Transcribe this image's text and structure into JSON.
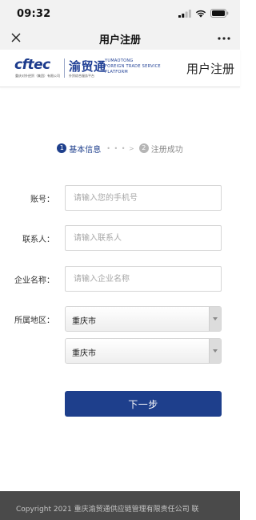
{
  "status_bar": {
    "time": "09:32"
  },
  "nav_bar": {
    "title": "用户注册"
  },
  "header": {
    "logo": {
      "cftec": "cftec",
      "cftec_sub": "重庆对外经贸（集团）有限公司",
      "yumaotong": "渝贸通",
      "yumaotong_sub": "外贸综合服务平台",
      "en_line1": "YUMAOTONG",
      "en_line2": "FOREIGN TRADE SERVICE",
      "en_line3": "PLATFORM"
    },
    "title": "用户注册"
  },
  "steps": [
    {
      "number": "1",
      "label": "基本信息"
    },
    {
      "arrow": "• • • >"
    },
    {
      "number": "2",
      "label": "注册成功"
    }
  ],
  "form": {
    "account": {
      "label": "账号：",
      "placeholder": "请输入您的手机号",
      "value": ""
    },
    "contact": {
      "label": "联系人：",
      "placeholder": "请输入联系人",
      "value": ""
    },
    "company": {
      "label": "企业名称：",
      "placeholder": "请输入企业名称",
      "value": ""
    },
    "region": {
      "label": "所属地区：",
      "province": "重庆市",
      "city": "重庆市"
    },
    "next_button": "下一步"
  },
  "footer": {
    "text": "Copyright 2021 重庆渝贸通供应链管理有限责任公司  联"
  },
  "colors": {
    "brand": "#1e3f8c",
    "footer_bg": "#4a4a4a"
  }
}
